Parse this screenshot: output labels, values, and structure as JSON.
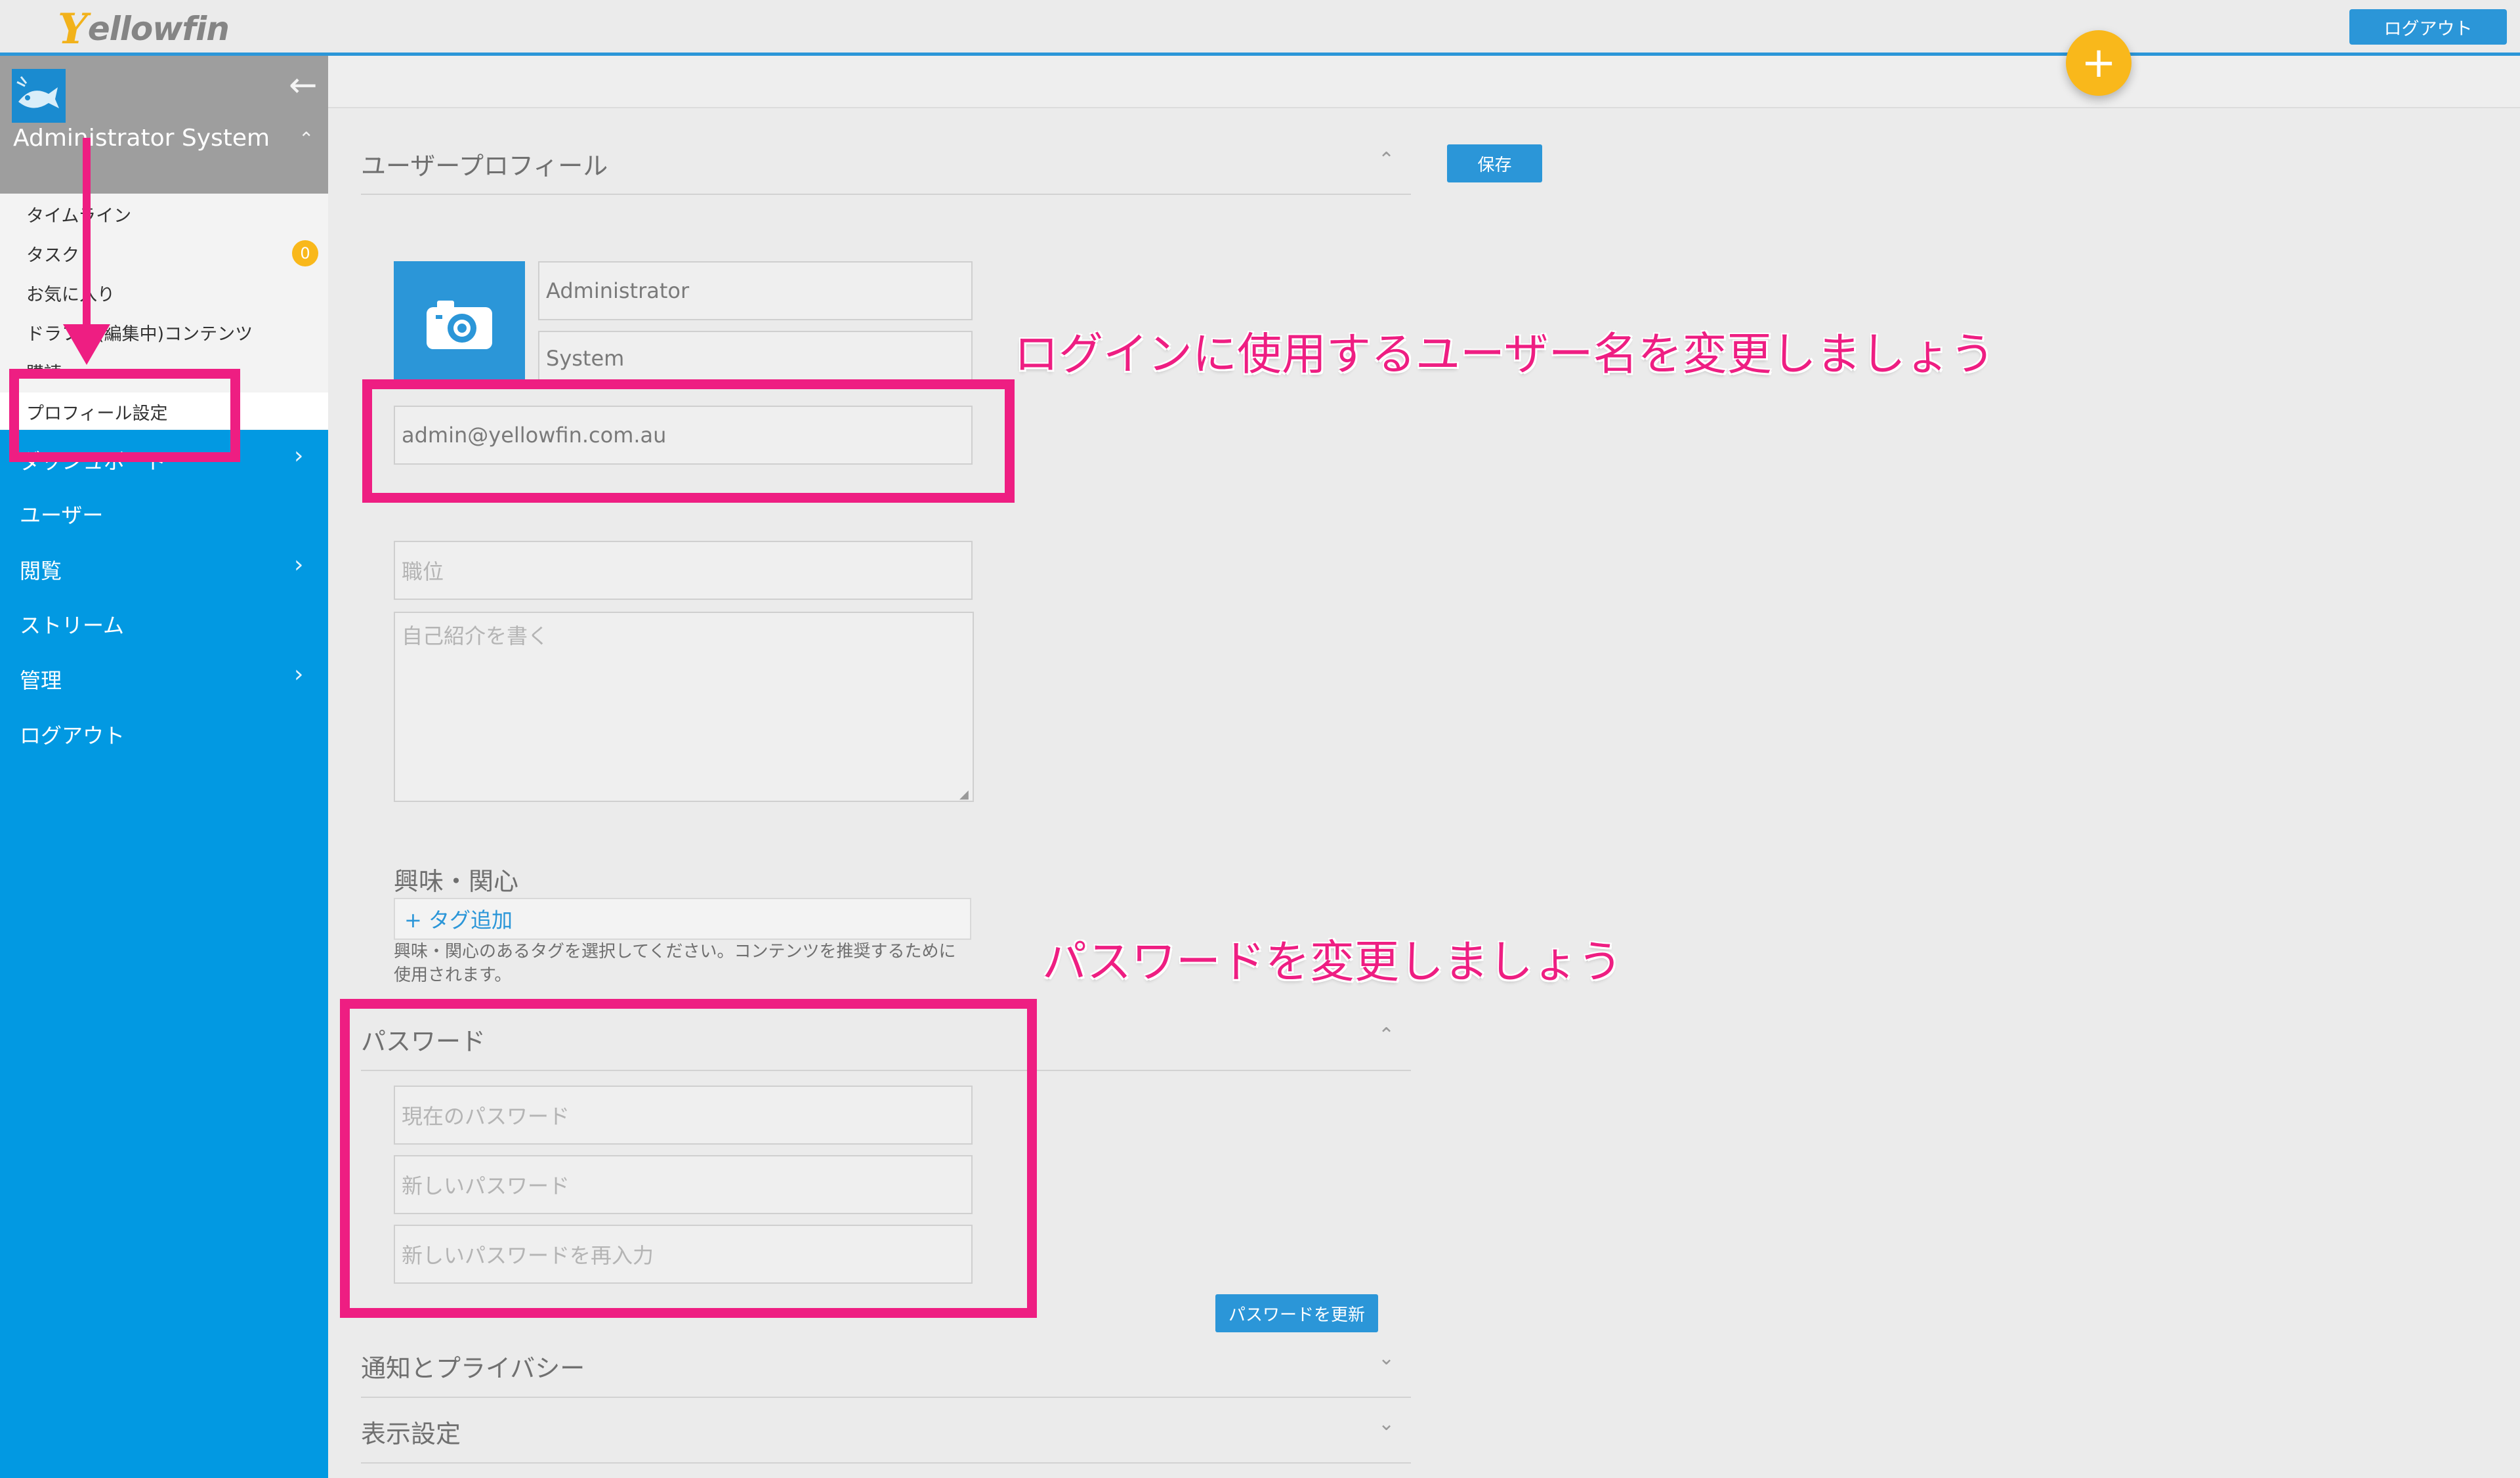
{
  "header": {
    "logo_first_letter": "Y",
    "logo_rest": "ellowfin",
    "logout_label": "ログアウト",
    "fab_label": "+"
  },
  "sidebar": {
    "user_name": "Administrator System",
    "submenu": [
      {
        "label": "タイムライン"
      },
      {
        "label": "タスク",
        "badge": "0"
      },
      {
        "label": "お気に入り"
      },
      {
        "label": "ドラフト(編集中)コンテンツ"
      },
      {
        "label": "購読"
      },
      {
        "label": "プロフィール設定"
      }
    ],
    "nav": [
      {
        "label": "ダッシュボード",
        "has_chevron": true
      },
      {
        "label": "ユーザー",
        "has_chevron": false
      },
      {
        "label": "閲覧",
        "has_chevron": true
      },
      {
        "label": "ストリーム",
        "has_chevron": false
      },
      {
        "label": "管理",
        "has_chevron": true
      },
      {
        "label": "ログアウト",
        "has_chevron": false
      }
    ]
  },
  "profile": {
    "section_title": "ユーザープロフィール",
    "save_label": "保存",
    "first_name": "Administrator",
    "last_name": "System",
    "email": "admin@yellowfin.com.au",
    "job_title_placeholder": "職位",
    "bio_placeholder": "自己紹介を書く",
    "interests_title": "興味・関心",
    "add_tag_label": "+ タグ追加",
    "interests_help": "興味・関心のあるタグを選択してください。コンテンツを推奨するために使用されます。"
  },
  "password": {
    "section_title": "パスワード",
    "current_placeholder": "現在のパスワード",
    "new_placeholder": "新しいパスワード",
    "confirm_placeholder": "新しいパスワードを再入力",
    "update_label": "パスワードを更新"
  },
  "sections": {
    "notifications_title": "通知とプライバシー",
    "display_title": "表示設定"
  },
  "annotations": {
    "username_note": "ログインに使用するユーザー名を変更しましょう",
    "password_note": "パスワードを変更しましょう"
  },
  "colors": {
    "brand_blue": "#2b96d8",
    "sidebar_blue": "#0299e2",
    "accent_yellow": "#f9b81b",
    "annotation_pink": "#ee1e82"
  }
}
